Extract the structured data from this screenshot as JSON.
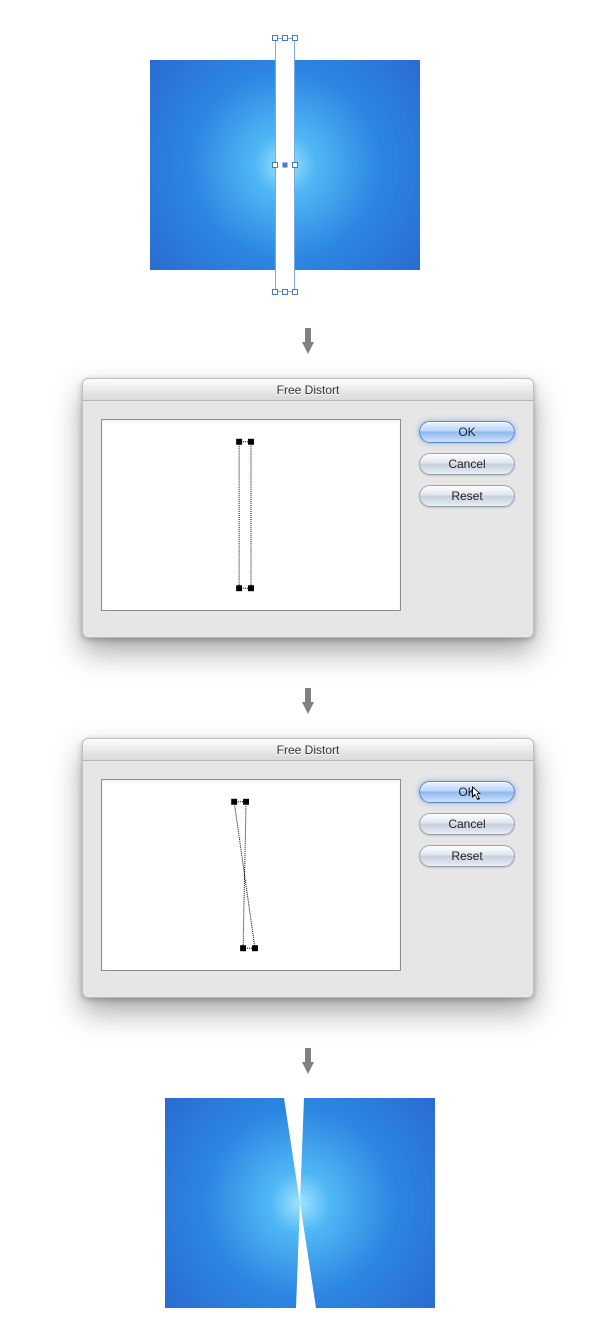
{
  "dialog": {
    "title": "Free Distort",
    "buttons": {
      "ok": "OK",
      "cancel": "Cancel",
      "reset": "Reset"
    }
  },
  "colors": {
    "blue_gradient_inner": "#9fe3ff",
    "blue_gradient_outer": "#2b6bd1",
    "selection": "#4a7acb"
  }
}
